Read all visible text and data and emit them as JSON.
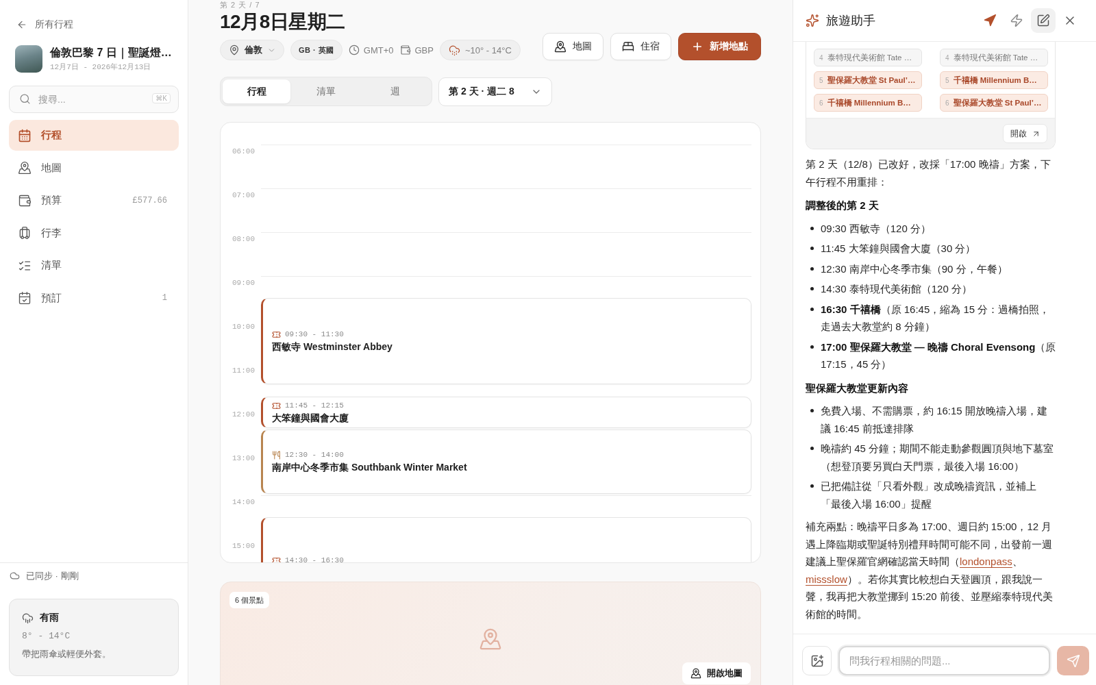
{
  "sidebar": {
    "back_link": "所有行程",
    "trip": {
      "title": "倫敦巴黎 7 日｜聖誕燈…",
      "dates": "12月7日 - 2026年12月13日"
    },
    "search": {
      "placeholder": "搜尋...",
      "shortcut": "⌘K"
    },
    "nav": [
      {
        "kind": "itinerary",
        "label": "行程",
        "selected": true
      },
      {
        "kind": "map",
        "label": "地圖",
        "selected": false
      },
      {
        "kind": "budget",
        "label": "預算",
        "value": "£577.66",
        "selected": false
      },
      {
        "kind": "luggage",
        "label": "行李",
        "selected": false
      },
      {
        "kind": "checklist",
        "label": "清單",
        "selected": false
      },
      {
        "kind": "bookings",
        "label": "預訂",
        "value": "1",
        "selected": false
      }
    ],
    "sync_status": "已同步 · 剛剛",
    "weather": {
      "condition": "有雨",
      "range": "8° - 14°C",
      "tip": "帶把雨傘或輕便外套。"
    }
  },
  "header": {
    "breadcrumb": "第 2 天 / 7",
    "title": "12月8日星期二",
    "chips": [
      {
        "kind": "city",
        "label": "倫敦"
      },
      {
        "kind": "country",
        "label": "GB · 英國"
      },
      {
        "kind": "timezone",
        "label": "GMT+0"
      },
      {
        "kind": "currency",
        "label": "GBP"
      },
      {
        "kind": "weather",
        "label": "~10° - 14°C"
      }
    ],
    "buttons": [
      {
        "kind": "map",
        "label": "地圖"
      },
      {
        "kind": "stay",
        "label": "住宿"
      },
      {
        "kind": "add",
        "label": "新增地點"
      }
    ]
  },
  "view_tabs": [
    {
      "label": "行程",
      "selected": true
    },
    {
      "label": "清單",
      "selected": false
    },
    {
      "label": "週",
      "selected": false
    }
  ],
  "day_select": {
    "label": "第 2 天 · 週二 8"
  },
  "timeline": {
    "hours": [
      "06:00",
      "07:00",
      "08:00",
      "09:00",
      "10:00",
      "11:00",
      "12:00",
      "13:00",
      "14:00",
      "15:00"
    ],
    "events": [
      {
        "kind": "sight",
        "time": "09:30 - 11:30",
        "name": "西敏寺 Westminster Abbey"
      },
      {
        "kind": "sight",
        "time": "11:45 - 12:15",
        "name": "大笨鐘與國會大廈"
      },
      {
        "kind": "food",
        "time": "12:30 - 14:00",
        "name": "南岸中心冬季市集 Southbank Winter Market"
      },
      {
        "kind": "sight",
        "time": "14:30 - 16:30"
      }
    ]
  },
  "map_preview": {
    "count": "6 個景點",
    "button": "開啟地圖"
  },
  "assistant": {
    "title": "旅遊助手",
    "tools": [
      {
        "kind": "locate",
        "selected": false
      },
      {
        "kind": "quick",
        "selected": false
      },
      {
        "kind": "compose",
        "selected": true
      },
      {
        "kind": "close",
        "selected": false
      }
    ],
    "comparison": {
      "columns": [
        {
          "items": [
            {
              "number": "4",
              "label": "泰特現代美術館 Tate …",
              "changed": false
            },
            {
              "number": "5",
              "label": "聖保羅大教堂 St Paul’…",
              "changed": true
            },
            {
              "number": "6",
              "label": "千禧橋 Millennium B…",
              "changed": true
            }
          ]
        },
        {
          "items": [
            {
              "number": "4",
              "label": "泰特現代美術館 Tate …",
              "changed": false
            },
            {
              "number": "5",
              "label": "千禧橋 Millennium B…",
              "changed": true
            },
            {
              "number": "6",
              "label": "聖保羅大教堂 St Paul’…",
              "changed": true
            }
          ]
        }
      ],
      "open_button": "開啟"
    },
    "message": {
      "intro": "第 2 天（12/8）已改好，改採「17:00 晚禱」方案，下午行程不用重排：",
      "sections": [
        {
          "heading": "調整後的第 2 天",
          "bullets": [
            "09:30 西敏寺（120 分）",
            "11:45 大笨鐘與國會大廈（30 分）",
            "12:30 南岸中心冬季市集（90 分，午餐）",
            "14:30 泰特現代美術館（120 分）",
            "**16:30 千禧橋**（原 16:45，縮為 15 分：過橋拍照，走過去大教堂約 8 分鐘）",
            "**17:00 聖保羅大教堂 — 晚禱 Choral Evensong**（原 17:15，45 分）"
          ]
        },
        {
          "heading": "聖保羅大教堂更新內容",
          "bullets": [
            "免費入場、不需購票，約 16:15 開放晚禱入場，建議 16:45 前抵達排隊",
            "晚禱約 45 分鐘；期間不能走動參觀圓頂與地下墓室（想登頂要另買白天門票，最後入場 16:00）",
            "已把備註從「只看外觀」改成晚禱資訊，並補上「最後入場 16:00」提醒"
          ]
        }
      ],
      "note": [
        {
          "kind": "text",
          "text": "補充兩點：晚禱平日多為 17:00、週日約 15:00，12 月遇上降臨期或聖誕特別禮拜時間可能不同，出發前一週建議上聖保羅官網確認當天時間（"
        },
        {
          "kind": "link",
          "text": "londonpass"
        },
        {
          "kind": "text",
          "text": "、"
        },
        {
          "kind": "link",
          "text": "missslow"
        },
        {
          "kind": "text",
          "text": "）。若你其實比較想白天登圓頂，跟我說一聲，我再把大教堂挪到 15:20 前後、並壓縮泰特現代美術館的時間。"
        }
      ]
    },
    "composer": {
      "placeholder": "問我行程相關的問題...",
      "send": {
        "disabled": true
      }
    }
  }
}
